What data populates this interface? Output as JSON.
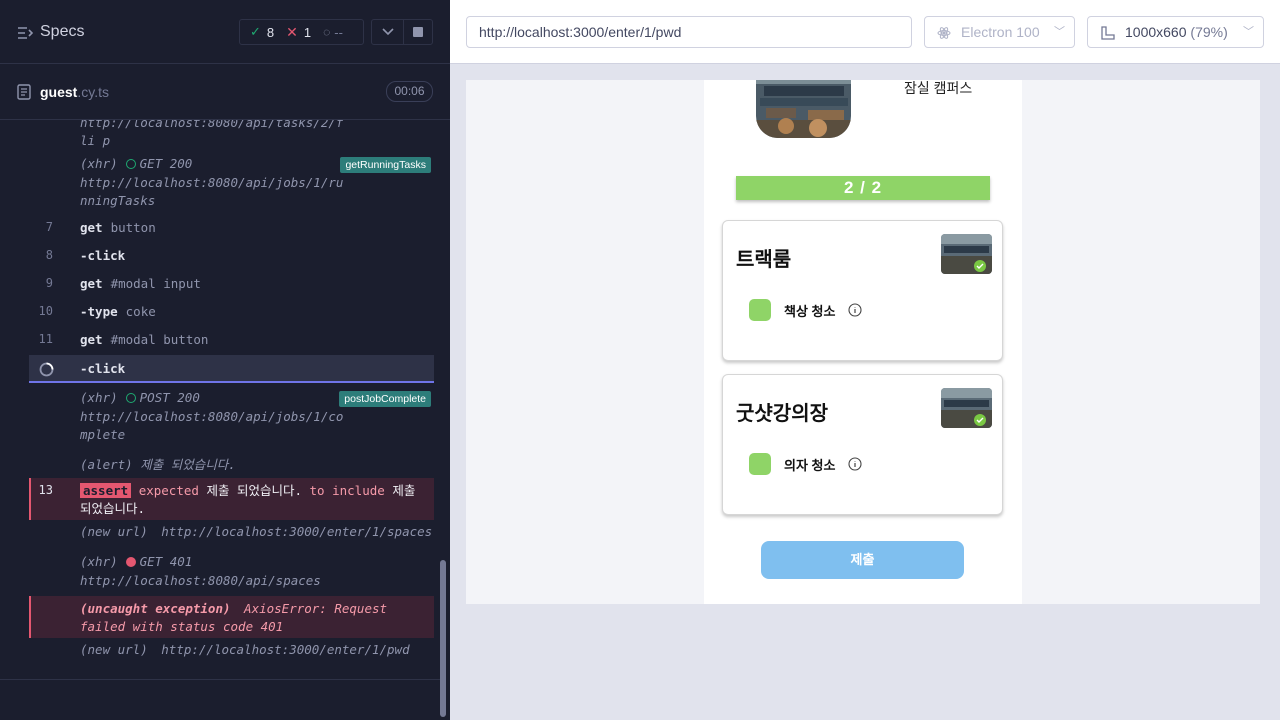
{
  "reporter": {
    "title": "Specs",
    "stats": {
      "passed": "8",
      "failed": "1",
      "pending": "--"
    },
    "spec_file": {
      "name": "guest",
      "ext": ".cy.ts",
      "duration": "00:06"
    },
    "log": {
      "prev_url_tail": "http://localhost:8080/api/tasks/2/fli p",
      "xhr1": {
        "type": "(xhr)",
        "method": "GET 200",
        "url": "http://localhost:8080/api/jobs/1/runningTasks",
        "alias": "getRunningTasks"
      },
      "c7": {
        "num": "7",
        "cmd": "get",
        "arg": "button"
      },
      "c8": {
        "num": "8",
        "cmd": "-click",
        "arg": ""
      },
      "c9": {
        "num": "9",
        "cmd": "get",
        "arg": "#modal input"
      },
      "c10": {
        "num": "10",
        "cmd": "-type",
        "arg": "coke"
      },
      "c11": {
        "num": "11",
        "cmd": "get",
        "arg": "#modal button"
      },
      "c12": {
        "cmd": "-click"
      },
      "xhr2": {
        "type": "(xhr)",
        "method": "POST 200",
        "url": "http://localhost:8080/api/jobs/1/complete",
        "alias": "postJobComplete"
      },
      "alert": {
        "type": "(alert)",
        "text": "제출 되었습니다."
      },
      "assert": {
        "num": "13",
        "tag": "assert",
        "t1": "expected",
        "v1": "제출 되었습니다.",
        "t2": "to include",
        "v2": "제출 되었습니다."
      },
      "nav1": {
        "type": "(new url)",
        "url": "http://localhost:3000/enter/1/spaces"
      },
      "xhr3": {
        "type": "(xhr)",
        "method": "GET 401",
        "url": "http://localhost:8080/api/spaces"
      },
      "exc": {
        "type": "(uncaught exception)",
        "msg": "AxiosError: Request failed with status code 401"
      },
      "nav2": {
        "type": "(new url)",
        "url": "http://localhost:3000/enter/1/pwd"
      }
    }
  },
  "browser": {
    "url": "http://localhost:3000/enter/1/pwd",
    "name": "Electron 100",
    "viewport": "1000x660",
    "scale": "(79%)"
  },
  "app": {
    "campus": "잠실 캠퍼스",
    "progress": "2 / 2",
    "spaces": [
      {
        "name": "트랙룸",
        "task": "책상 청소"
      },
      {
        "name": "굿샷강의장",
        "task": "의자 청소"
      }
    ],
    "submit": "제출"
  }
}
